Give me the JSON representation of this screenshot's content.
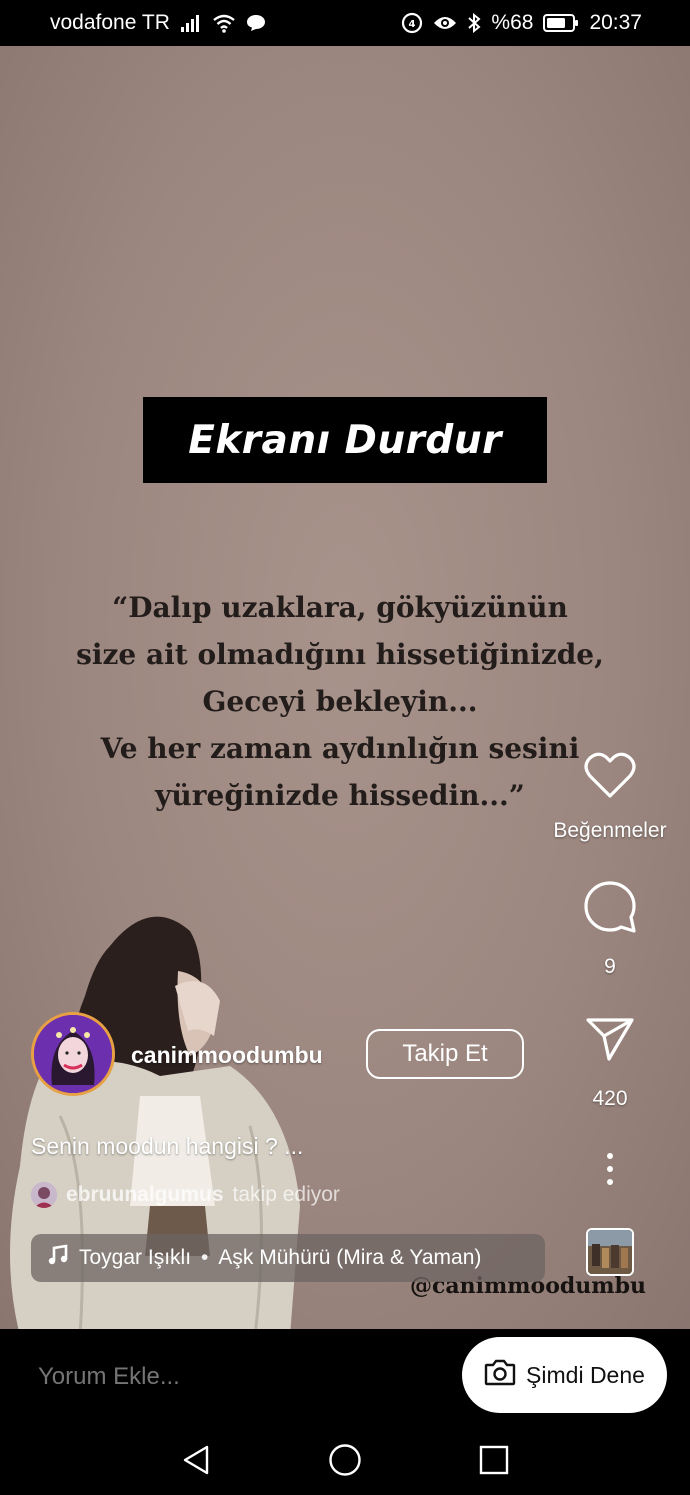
{
  "status_bar": {
    "carrier": "vodafone TR",
    "battery_percent": "%68",
    "time": "20:37",
    "icons": [
      "signal-icon",
      "wifi-icon",
      "chat-bubble-icon",
      "data-saver-icon",
      "eye-icon",
      "bluetooth-icon",
      "battery-icon"
    ]
  },
  "video": {
    "banner_text": "Ekranı Durdur",
    "quote_lines": [
      "“Dalıp uzaklara, gökyüzünün",
      "size ait olmadığını hissetiğinizde,",
      "Geceyi bekleyin...",
      "Ve her zaman aydınlığın sesini",
      "yüreğinizde hissedin...”"
    ],
    "watermark": "@canimmoodumbu"
  },
  "actions": {
    "like_label": "Beğenmeler",
    "comment_count": "9",
    "share_count": "420"
  },
  "post": {
    "username": "canimmoodumbu",
    "follow_label": "Takip Et",
    "caption": "Senin moodun hangisi ? ...",
    "follower_user": "ebruunalgumus",
    "follower_text": "takip ediyor",
    "music_artist": "Toygar Işıklı",
    "music_separator": "•",
    "music_title": "Aşk Mühürü (Mira & Yaman)"
  },
  "comment_bar": {
    "placeholder": "Yorum Ekle...",
    "try_label": "Şimdi Dene"
  },
  "colors": {
    "video_bg": "#9c8780",
    "avatar_ring": "#e7a043",
    "avatar_bg": "#6c2fae"
  }
}
